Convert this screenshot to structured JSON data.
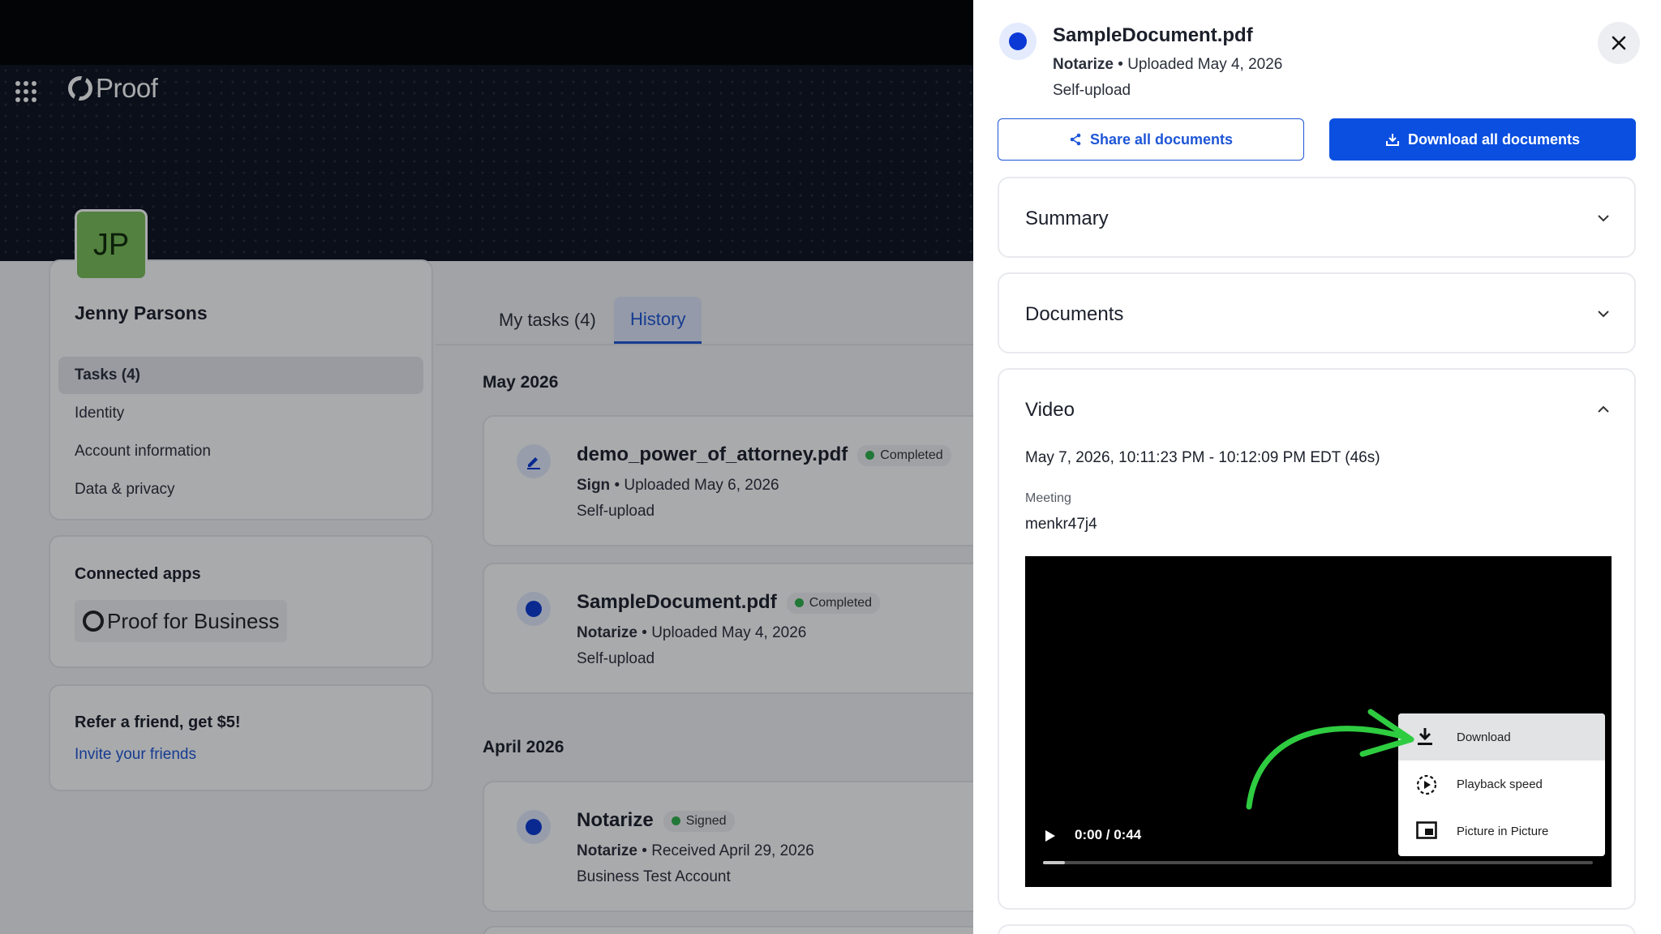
{
  "app": {
    "brand": "Proof",
    "profile": {
      "initials": "JP",
      "name": "Jenny Parsons",
      "avatar_color": "#7cc15a",
      "nav": [
        {
          "label": "Tasks (4)",
          "active": true
        },
        {
          "label": "Identity"
        },
        {
          "label": "Account information"
        },
        {
          "label": "Data & privacy"
        }
      ]
    },
    "connected_apps": {
      "title": "Connected apps",
      "app_name": "Proof for Business"
    },
    "refer": {
      "title": "Refer a friend, get $5!",
      "link": "Invite your friends"
    },
    "tabs": [
      {
        "label": "My tasks (4)"
      },
      {
        "label": "History",
        "active": true
      }
    ],
    "groups": [
      {
        "month": "May 2026",
        "tasks": [
          {
            "title": "demo_power_of_attorney.pdf",
            "status": "Completed",
            "type": "Sign",
            "detail": "Uploaded May 6, 2026",
            "source": "Self-upload",
            "icon": "pen-icon"
          },
          {
            "title": "SampleDocument.pdf",
            "status": "Completed",
            "type": "Notarize",
            "detail": "Uploaded May 4, 2026",
            "source": "Self-upload",
            "icon": "notarize-dot-icon"
          }
        ]
      },
      {
        "month": "April 2026",
        "tasks": [
          {
            "title": "Notarize",
            "status": "Signed",
            "type": "Notarize",
            "detail": "Received April 29, 2026",
            "source": "Business Test Account",
            "icon": "notarize-dot-icon"
          }
        ]
      }
    ]
  },
  "drawer": {
    "title": "SampleDocument.pdf",
    "type": "Notarize",
    "detail": "Uploaded May 4, 2026",
    "source": "Self-upload",
    "share_label": "Share all documents",
    "download_label": "Download all documents",
    "sections": {
      "summary": "Summary",
      "documents": "Documents",
      "video": "Video"
    },
    "video": {
      "time_range": "May 7, 2026, 10:11:23 PM - 10:12:09 PM EDT (46s)",
      "meeting_label": "Meeting",
      "meeting_id": "menkr47j4",
      "time_display": "0:00 / 0:44",
      "progress": 0.04,
      "menu": [
        {
          "label": "Download",
          "icon": "download-icon",
          "highlighted": true
        },
        {
          "label": "Playback speed",
          "icon": "playback-speed-icon"
        },
        {
          "label": "Picture in Picture",
          "icon": "picture-in-picture-icon"
        }
      ]
    },
    "colors": {
      "primary": "#0a4fe0",
      "annotation_arrow": "#2ecc40"
    }
  }
}
